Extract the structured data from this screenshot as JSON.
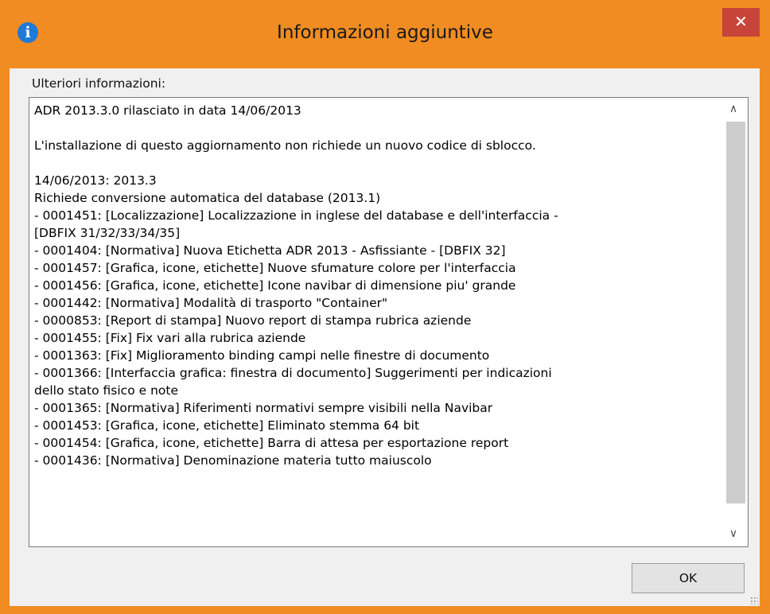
{
  "window": {
    "title": "Informazioni aggiuntive",
    "close_glyph": "✕",
    "info_icon_glyph": "i"
  },
  "section_label": "Ulteriori informazioni:",
  "details_text": "ADR 2013.3.0 rilasciato in data 14/06/2013\n\nL'installazione di questo aggiornamento non richiede un nuovo codice di sblocco.\n\n14/06/2013: 2013.3\nRichiede conversione automatica del database (2013.1)\n- 0001451: [Localizzazione] Localizzazione in inglese del database e dell'interfaccia -\n[DBFIX 31/32/33/34/35]\n- 0001404: [Normativa] Nuova Etichetta ADR 2013 - Asfissiante - [DBFIX 32]\n- 0001457: [Grafica, icone, etichette] Nuove sfumature colore per l'interfaccia\n- 0001456: [Grafica, icone, etichette] Icone navibar di dimensione piu' grande\n- 0001442: [Normativa] Modalità di trasporto \"Container\"\n- 0000853: [Report di stampa] Nuovo report di stampa rubrica aziende\n- 0001455: [Fix] Fix vari alla rubrica aziende\n- 0001363: [Fix] Miglioramento binding campi nelle finestre di documento\n- 0001366: [Interfaccia grafica: finestra di documento] Suggerimenti per indicazioni\ndello stato fisico e note\n- 0001365: [Normativa] Riferimenti normativi sempre visibili nella Navibar\n- 0001453: [Grafica, icone, etichette] Eliminato stemma 64 bit\n- 0001454: [Grafica, icone, etichette] Barra di attesa per esportazione report\n- 0001436: [Normativa] Denominazione materia tutto maiuscolo",
  "scrollbar": {
    "up_glyph": "∧",
    "down_glyph": "∨"
  },
  "ok_button_label": "OK",
  "colors": {
    "window_frame": "#f08c22",
    "close_button": "#c7443b",
    "info_icon": "#1f79d6",
    "dialog_background": "#f0f0f0"
  }
}
